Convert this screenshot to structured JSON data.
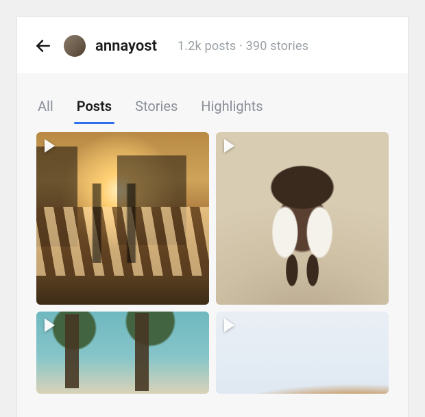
{
  "header": {
    "username": "annayost",
    "stats_text": "1.2k posts · 390 stories"
  },
  "tabs": [
    {
      "label": "All",
      "active": false
    },
    {
      "label": "Posts",
      "active": true
    },
    {
      "label": "Stories",
      "active": false
    },
    {
      "label": "Highlights",
      "active": false
    }
  ],
  "posts": [
    {
      "name": "post-street-sunset",
      "has_video": true
    },
    {
      "name": "post-running-dog",
      "has_video": true
    },
    {
      "name": "post-trees-sky",
      "has_video": true
    },
    {
      "name": "post-desert-hill",
      "has_video": true
    }
  ]
}
